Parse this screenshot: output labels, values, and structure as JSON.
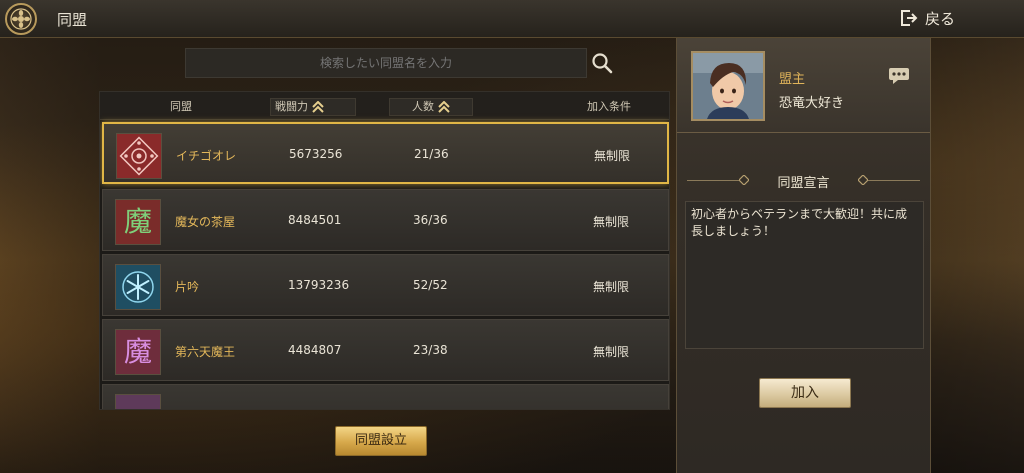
{
  "header": {
    "title": "同盟",
    "back_label": "戻る"
  },
  "search": {
    "placeholder": "検索したい同盟名を入力"
  },
  "table": {
    "columns": {
      "alliance": "同盟",
      "power": "戦闘力",
      "members": "人数",
      "condition": "加入条件"
    },
    "rows": [
      {
        "name": "イチゴオレ",
        "power": "5673256",
        "members": "21/36",
        "condition": "無制限",
        "icon": "crest-icon"
      },
      {
        "name": "魔女の茶屋",
        "power": "8484501",
        "members": "36/36",
        "condition": "無制限",
        "icon": "demon-kanji-icon"
      },
      {
        "name": "片吟",
        "power": "13793236",
        "members": "52/52",
        "condition": "無制限",
        "icon": "snowflake-icon"
      },
      {
        "name": "第六天魔王",
        "power": "4484807",
        "members": "23/38",
        "condition": "無制限",
        "icon": "demon-kanji-icon"
      }
    ]
  },
  "create_button": "同盟設立",
  "leader": {
    "role": "盟主",
    "name": "恐竜大好き"
  },
  "declaration": {
    "title": "同盟宣言",
    "text": "初心者からベテランまで大歓迎！共に成長しましょう！"
  },
  "join_button": "加入",
  "colors": {
    "accent_gold": "#e0b646",
    "name_gold": "#e3b75a"
  }
}
